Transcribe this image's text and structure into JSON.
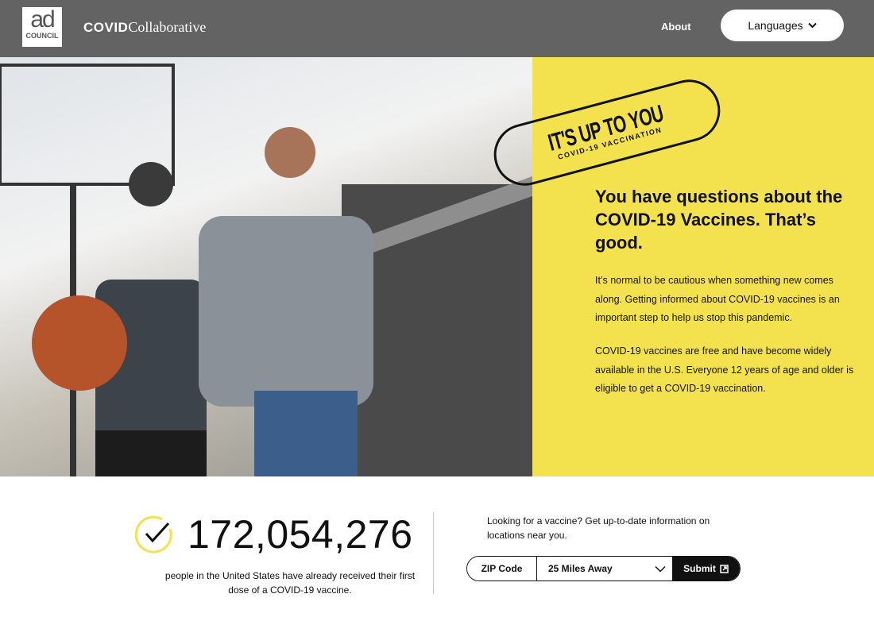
{
  "header": {
    "logo_ad": "ad",
    "logo_council": "COUNCIL",
    "brand_bold": "COVID",
    "brand_rest": "Collaborative",
    "about": "About",
    "languages": "Languages"
  },
  "hero": {
    "image_alt": "Father and son walking with a basketball",
    "stamp_title": "IT'S UP TO YOU",
    "stamp_subtitle": "COVID-19 VACCINATION",
    "headline": "You have questions about the COVID-19 Vaccines. That’s good.",
    "paragraph1": "It’s normal to be cautious when something new comes along. Getting informed about COVID-19 vaccines is an important step to help us stop this pandemic.",
    "paragraph2": "COVID-19 vaccines are free and have become widely available in the U.S. Everyone 12 years of age and older is eligible to get a COVID-19 vaccination."
  },
  "stats": {
    "count": "172,054,276",
    "caption": "people in the United States have already received their first dose of a COVID-19 vaccine.",
    "check_color": "#f3e24e"
  },
  "finder": {
    "prompt": "Looking for a vaccine? Get up-to-date information on locations near you.",
    "zip_placeholder": "ZIP Code",
    "distance": "25 Miles Away",
    "submit": "Submit"
  },
  "colors": {
    "header": "#636363",
    "accent": "#f3e24e"
  }
}
